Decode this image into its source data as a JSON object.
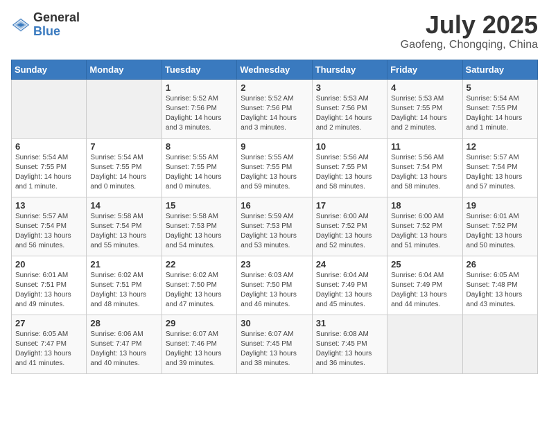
{
  "header": {
    "logo_general": "General",
    "logo_blue": "Blue",
    "main_title": "July 2025",
    "subtitle": "Gaofeng, Chongqing, China"
  },
  "calendar": {
    "weekdays": [
      "Sunday",
      "Monday",
      "Tuesday",
      "Wednesday",
      "Thursday",
      "Friday",
      "Saturday"
    ],
    "weeks": [
      [
        {
          "day": "",
          "info": ""
        },
        {
          "day": "",
          "info": ""
        },
        {
          "day": "1",
          "info": "Sunrise: 5:52 AM\nSunset: 7:56 PM\nDaylight: 14 hours and 3 minutes."
        },
        {
          "day": "2",
          "info": "Sunrise: 5:52 AM\nSunset: 7:56 PM\nDaylight: 14 hours and 3 minutes."
        },
        {
          "day": "3",
          "info": "Sunrise: 5:53 AM\nSunset: 7:56 PM\nDaylight: 14 hours and 2 minutes."
        },
        {
          "day": "4",
          "info": "Sunrise: 5:53 AM\nSunset: 7:55 PM\nDaylight: 14 hours and 2 minutes."
        },
        {
          "day": "5",
          "info": "Sunrise: 5:54 AM\nSunset: 7:55 PM\nDaylight: 14 hours and 1 minute."
        }
      ],
      [
        {
          "day": "6",
          "info": "Sunrise: 5:54 AM\nSunset: 7:55 PM\nDaylight: 14 hours and 1 minute."
        },
        {
          "day": "7",
          "info": "Sunrise: 5:54 AM\nSunset: 7:55 PM\nDaylight: 14 hours and 0 minutes."
        },
        {
          "day": "8",
          "info": "Sunrise: 5:55 AM\nSunset: 7:55 PM\nDaylight: 14 hours and 0 minutes."
        },
        {
          "day": "9",
          "info": "Sunrise: 5:55 AM\nSunset: 7:55 PM\nDaylight: 13 hours and 59 minutes."
        },
        {
          "day": "10",
          "info": "Sunrise: 5:56 AM\nSunset: 7:55 PM\nDaylight: 13 hours and 58 minutes."
        },
        {
          "day": "11",
          "info": "Sunrise: 5:56 AM\nSunset: 7:54 PM\nDaylight: 13 hours and 58 minutes."
        },
        {
          "day": "12",
          "info": "Sunrise: 5:57 AM\nSunset: 7:54 PM\nDaylight: 13 hours and 57 minutes."
        }
      ],
      [
        {
          "day": "13",
          "info": "Sunrise: 5:57 AM\nSunset: 7:54 PM\nDaylight: 13 hours and 56 minutes."
        },
        {
          "day": "14",
          "info": "Sunrise: 5:58 AM\nSunset: 7:54 PM\nDaylight: 13 hours and 55 minutes."
        },
        {
          "day": "15",
          "info": "Sunrise: 5:58 AM\nSunset: 7:53 PM\nDaylight: 13 hours and 54 minutes."
        },
        {
          "day": "16",
          "info": "Sunrise: 5:59 AM\nSunset: 7:53 PM\nDaylight: 13 hours and 53 minutes."
        },
        {
          "day": "17",
          "info": "Sunrise: 6:00 AM\nSunset: 7:52 PM\nDaylight: 13 hours and 52 minutes."
        },
        {
          "day": "18",
          "info": "Sunrise: 6:00 AM\nSunset: 7:52 PM\nDaylight: 13 hours and 51 minutes."
        },
        {
          "day": "19",
          "info": "Sunrise: 6:01 AM\nSunset: 7:52 PM\nDaylight: 13 hours and 50 minutes."
        }
      ],
      [
        {
          "day": "20",
          "info": "Sunrise: 6:01 AM\nSunset: 7:51 PM\nDaylight: 13 hours and 49 minutes."
        },
        {
          "day": "21",
          "info": "Sunrise: 6:02 AM\nSunset: 7:51 PM\nDaylight: 13 hours and 48 minutes."
        },
        {
          "day": "22",
          "info": "Sunrise: 6:02 AM\nSunset: 7:50 PM\nDaylight: 13 hours and 47 minutes."
        },
        {
          "day": "23",
          "info": "Sunrise: 6:03 AM\nSunset: 7:50 PM\nDaylight: 13 hours and 46 minutes."
        },
        {
          "day": "24",
          "info": "Sunrise: 6:04 AM\nSunset: 7:49 PM\nDaylight: 13 hours and 45 minutes."
        },
        {
          "day": "25",
          "info": "Sunrise: 6:04 AM\nSunset: 7:49 PM\nDaylight: 13 hours and 44 minutes."
        },
        {
          "day": "26",
          "info": "Sunrise: 6:05 AM\nSunset: 7:48 PM\nDaylight: 13 hours and 43 minutes."
        }
      ],
      [
        {
          "day": "27",
          "info": "Sunrise: 6:05 AM\nSunset: 7:47 PM\nDaylight: 13 hours and 41 minutes."
        },
        {
          "day": "28",
          "info": "Sunrise: 6:06 AM\nSunset: 7:47 PM\nDaylight: 13 hours and 40 minutes."
        },
        {
          "day": "29",
          "info": "Sunrise: 6:07 AM\nSunset: 7:46 PM\nDaylight: 13 hours and 39 minutes."
        },
        {
          "day": "30",
          "info": "Sunrise: 6:07 AM\nSunset: 7:45 PM\nDaylight: 13 hours and 38 minutes."
        },
        {
          "day": "31",
          "info": "Sunrise: 6:08 AM\nSunset: 7:45 PM\nDaylight: 13 hours and 36 minutes."
        },
        {
          "day": "",
          "info": ""
        },
        {
          "day": "",
          "info": ""
        }
      ]
    ]
  }
}
